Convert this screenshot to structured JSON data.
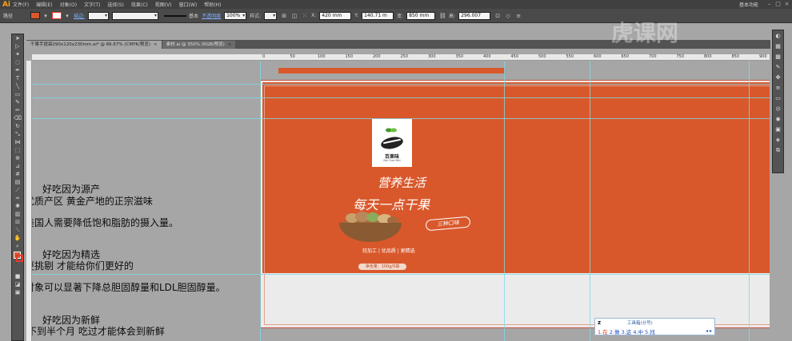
{
  "app": {
    "logo": "Ai",
    "workspace_label": "基本功能"
  },
  "menu": [
    "文件(F)",
    "编辑(E)",
    "对象(O)",
    "文字(T)",
    "选择(S)",
    "效果(C)",
    "视图(V)",
    "窗口(W)",
    "帮助(H)"
  ],
  "controls": {
    "selection_label": "路径",
    "stroke_label": "描边:",
    "stroke_style": "基本",
    "opacity_label": "不透明度",
    "opacity_value": "100%",
    "style_label": "样式:",
    "x_label": "X:",
    "x_value": "420 mm",
    "y_label": "Y:",
    "y_value": "140.71 m",
    "w_label": "宽:",
    "w_value": "850 mm",
    "h_label": "高:",
    "h_value": "296.007"
  },
  "tabs": [
    {
      "label": "干果手提袋290x120x230mm.ai* @ 66.67% (CMYK/预览)",
      "active": false
    },
    {
      "label": "素材.ai @ 350% (RGB/预览)",
      "active": false
    }
  ],
  "doc_header": "干果手提袋290x120x230mm.ai* @ 66.67% (CMYK/预览)",
  "ruler_ticks": [
    "0",
    "50",
    "100",
    "150",
    "200",
    "250",
    "300",
    "350",
    "400",
    "450",
    "500",
    "550",
    "600",
    "650",
    "700",
    "750",
    "800",
    "850",
    "900"
  ],
  "artwork": {
    "brand_name": "百果味",
    "brand_en": "Bai Guo Wei",
    "slogan_line1": "营养生活",
    "slogan_line2": "每天一点干果",
    "badge": "三种口味",
    "features": "轻加工 | 优品质 | 更精选",
    "net_weight": "净含量：100g/5袋",
    "colors": {
      "panel": "#d9582b",
      "board": "#ebebeb"
    }
  },
  "captions": [
    "好吃因为源产",
    "优质产区 黄金产地的正宗滋味",
    "美国人需要降低饱和脂肪的摄入量。",
    "好吃因为精选",
    "更挑剔 才能给你们更好的",
    "对象可以显著下降总胆固醇量和LDL胆固醇量。",
    "好吃因为新鲜",
    "加工不到半个月 吃过才能体会到新鲜"
  ],
  "ime": {
    "input": "z",
    "title": "工具箱(分号)",
    "candidates": [
      "1.在",
      "2.做",
      "3.这",
      "4.中",
      "5.找"
    ]
  },
  "watermark": "虎课网"
}
